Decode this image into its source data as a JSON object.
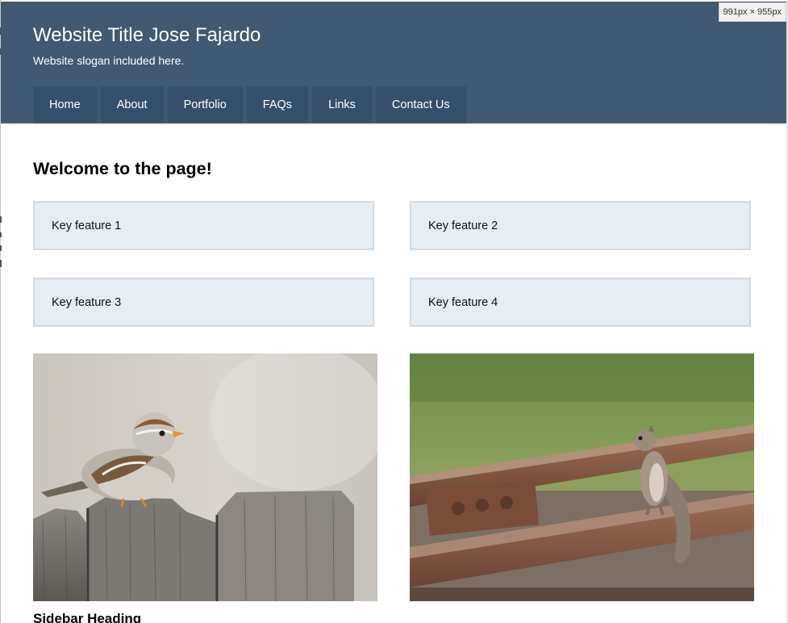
{
  "header": {
    "title": "Website Title Jose Fajardo",
    "slogan": "Website slogan included here."
  },
  "nav": {
    "items": [
      {
        "label": "Home"
      },
      {
        "label": "About"
      },
      {
        "label": "Portfolio"
      },
      {
        "label": "FAQs"
      },
      {
        "label": "Links"
      },
      {
        "label": "Contact Us"
      }
    ]
  },
  "viewport_badge": "991px × 955px",
  "main": {
    "heading": "Welcome to the page!",
    "features": [
      {
        "label": "Key feature 1"
      },
      {
        "label": "Key feature 2"
      },
      {
        "label": "Key feature 3"
      },
      {
        "label": "Key feature 4"
      }
    ],
    "images": [
      {
        "subject": "sparrow-on-wooden-fence"
      },
      {
        "subject": "squirrel-on-railroad-track"
      }
    ]
  },
  "sidebar": {
    "heading": "Sidebar Heading"
  },
  "colors": {
    "header_bg": "#3f5a72",
    "nav_item_bg": "#35506a",
    "feature_bg": "#e6edf3",
    "feature_border": "#cfdbe5"
  }
}
